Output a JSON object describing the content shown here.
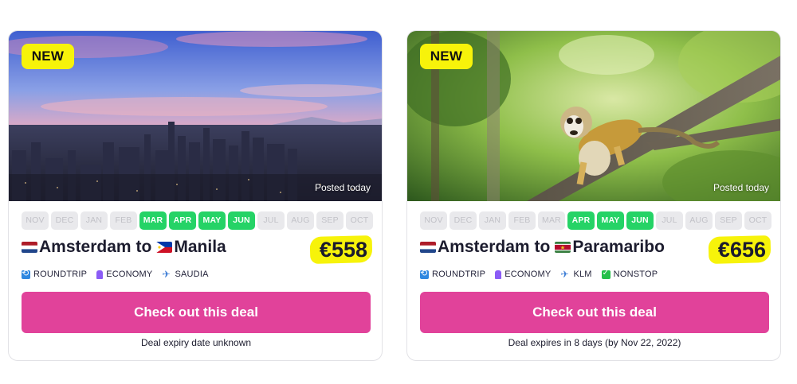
{
  "deals": [
    {
      "badge": "NEW",
      "posted": "Posted today",
      "months": [
        {
          "label": "NOV",
          "active": false
        },
        {
          "label": "DEC",
          "active": false
        },
        {
          "label": "JAN",
          "active": false
        },
        {
          "label": "FEB",
          "active": false
        },
        {
          "label": "MAR",
          "active": true
        },
        {
          "label": "APR",
          "active": true
        },
        {
          "label": "MAY",
          "active": true
        },
        {
          "label": "JUN",
          "active": true
        },
        {
          "label": "JUL",
          "active": false
        },
        {
          "label": "AUG",
          "active": false
        },
        {
          "label": "SEP",
          "active": false
        },
        {
          "label": "OCT",
          "active": false
        }
      ],
      "from": "Amsterdam",
      "to_word": "to",
      "destination": "Manila",
      "from_flag": "flag-netherlands",
      "dest_flag": "flag-philippines",
      "price": "€558",
      "tags": [
        {
          "icon": "roundtrip-icon",
          "label": "ROUNDTRIP"
        },
        {
          "icon": "seat-icon",
          "label": "ECONOMY"
        },
        {
          "icon": "airplane-icon",
          "label": "SAUDIA"
        }
      ],
      "cta": "Check out this deal",
      "expiry": "Deal expiry date unknown"
    },
    {
      "badge": "NEW",
      "posted": "Posted today",
      "months": [
        {
          "label": "NOV",
          "active": false
        },
        {
          "label": "DEC",
          "active": false
        },
        {
          "label": "JAN",
          "active": false
        },
        {
          "label": "FEB",
          "active": false
        },
        {
          "label": "MAR",
          "active": false
        },
        {
          "label": "APR",
          "active": true
        },
        {
          "label": "MAY",
          "active": true
        },
        {
          "label": "JUN",
          "active": true
        },
        {
          "label": "JUL",
          "active": false
        },
        {
          "label": "AUG",
          "active": false
        },
        {
          "label": "SEP",
          "active": false
        },
        {
          "label": "OCT",
          "active": false
        }
      ],
      "from": "Amsterdam",
      "to_word": "to",
      "destination": "Paramaribo",
      "from_flag": "flag-netherlands",
      "dest_flag": "flag-suriname",
      "price": "€656",
      "tags": [
        {
          "icon": "roundtrip-icon",
          "label": "ROUNDTRIP"
        },
        {
          "icon": "seat-icon",
          "label": "ECONOMY"
        },
        {
          "icon": "airplane-icon",
          "label": "KLM"
        },
        {
          "icon": "check-icon",
          "label": "NONSTOP"
        }
      ],
      "cta": "Check out this deal",
      "expiry": "Deal expires in 8 days (by Nov 22, 2022)"
    }
  ],
  "colors": {
    "badge": "#f7f30a",
    "month_active": "#25d366",
    "month_inactive": "#e9e9ec",
    "cta": "#e1429a"
  }
}
